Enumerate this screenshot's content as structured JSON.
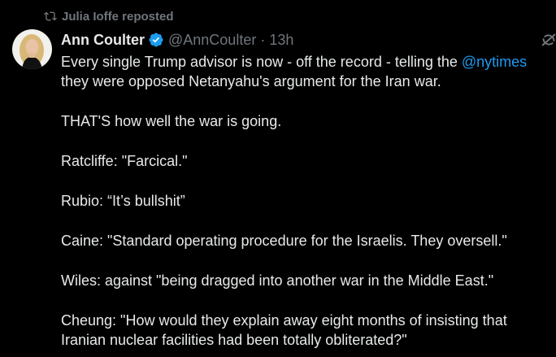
{
  "repost": {
    "text": "Julia Ioffe reposted",
    "icon": "repost-icon"
  },
  "author": {
    "name": "Ann Coulter",
    "handle": "@AnnCoulter",
    "separator": "·",
    "time": "13h",
    "verified_color": "#1d9bf0"
  },
  "tweet": {
    "line1_prefix": "Every single Trump advisor is now - off the record - telling the ",
    "mention": "@nytimes",
    "line2": "they were opposed Netanyahu's argument for the Iran war.",
    "line3": "THAT'S how well the war is going.",
    "line4": "Ratcliffe: \"Farcical.\"",
    "line5": "Rubio: “It’s bullshit”",
    "line6": "Caine: \"Standard operating procedure for the Israelis. They oversell.\"",
    "line7": "Wiles: against \"being dragged into another war in the Middle East.\"",
    "line8": "Cheung: \"How would they explain away eight months of insisting that",
    "line9": "Iranian nuclear facilities had been totally obliterated?\""
  },
  "colors": {
    "background": "#000000",
    "text": "#e7e9ea",
    "muted": "#71767b",
    "link": "#1d9bf0"
  }
}
